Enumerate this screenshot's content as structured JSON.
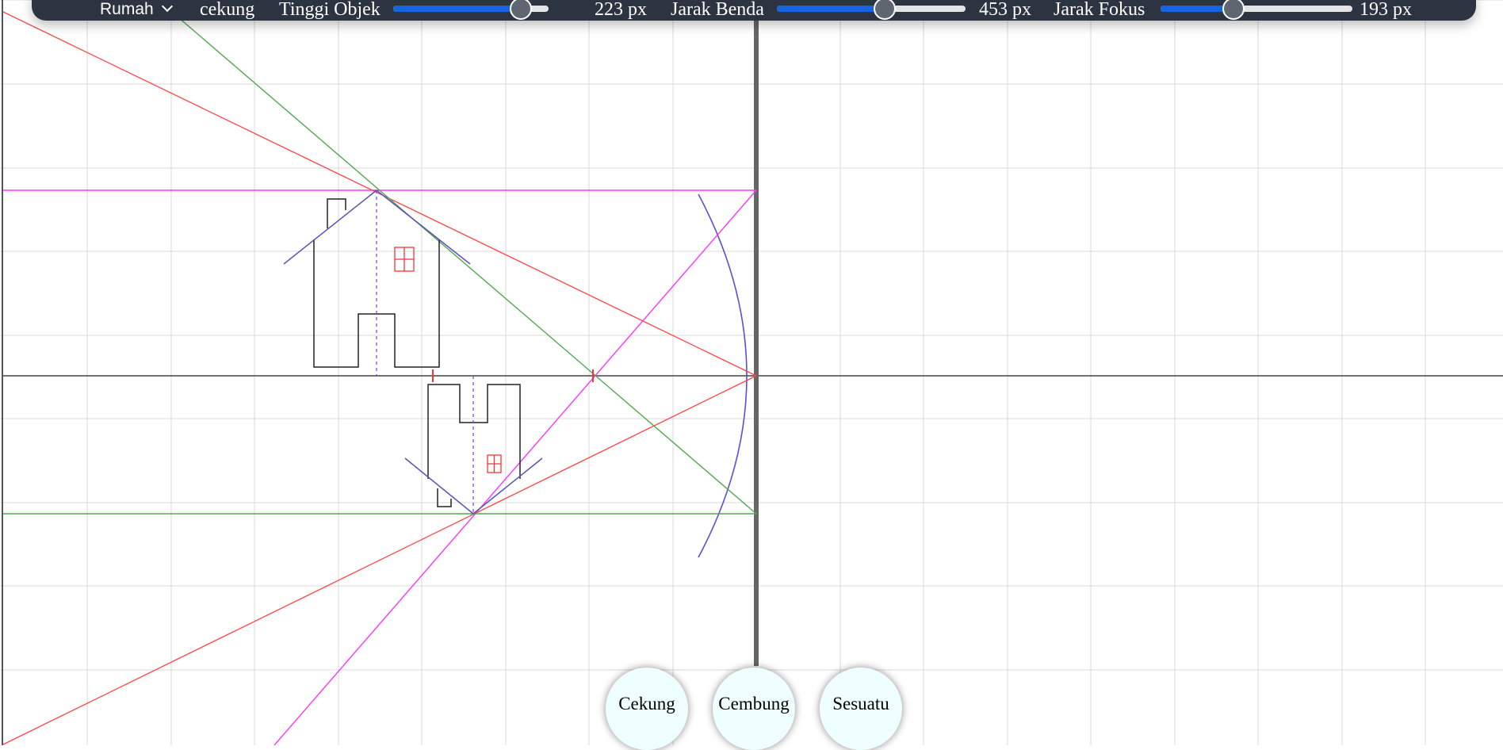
{
  "toolbar": {
    "object_type": "Rumah",
    "mirror_type": "cekung",
    "height_label": "Tinggi Objek",
    "height_value": "223 px",
    "height_level": 0.82,
    "distance_label": "Jarak Benda",
    "distance_value": "453 px",
    "distance_level": 0.57,
    "focal_label": "Jarak Fokus",
    "focal_value": "193 px",
    "focal_level": 0.38
  },
  "buttons": {
    "concave": "Cekung",
    "convex": "Cembung",
    "other": "Sesuatu"
  },
  "colors": {
    "grid": "#d8d8d8",
    "axis": "#444444",
    "mirror_line": "#666666",
    "mirror_arc": "#5a4fdc",
    "ray_red": "#ff4444",
    "ray_green": "#52a852",
    "ray_magenta": "#ff33ff",
    "house": "#222222",
    "window": "#ff3333",
    "roof": "#5a52b8",
    "center_line": "#8a3ad0",
    "toolbar_bg": "#2b3440",
    "slider_fill": "#1565e0",
    "button_bg": "#effefe"
  }
}
